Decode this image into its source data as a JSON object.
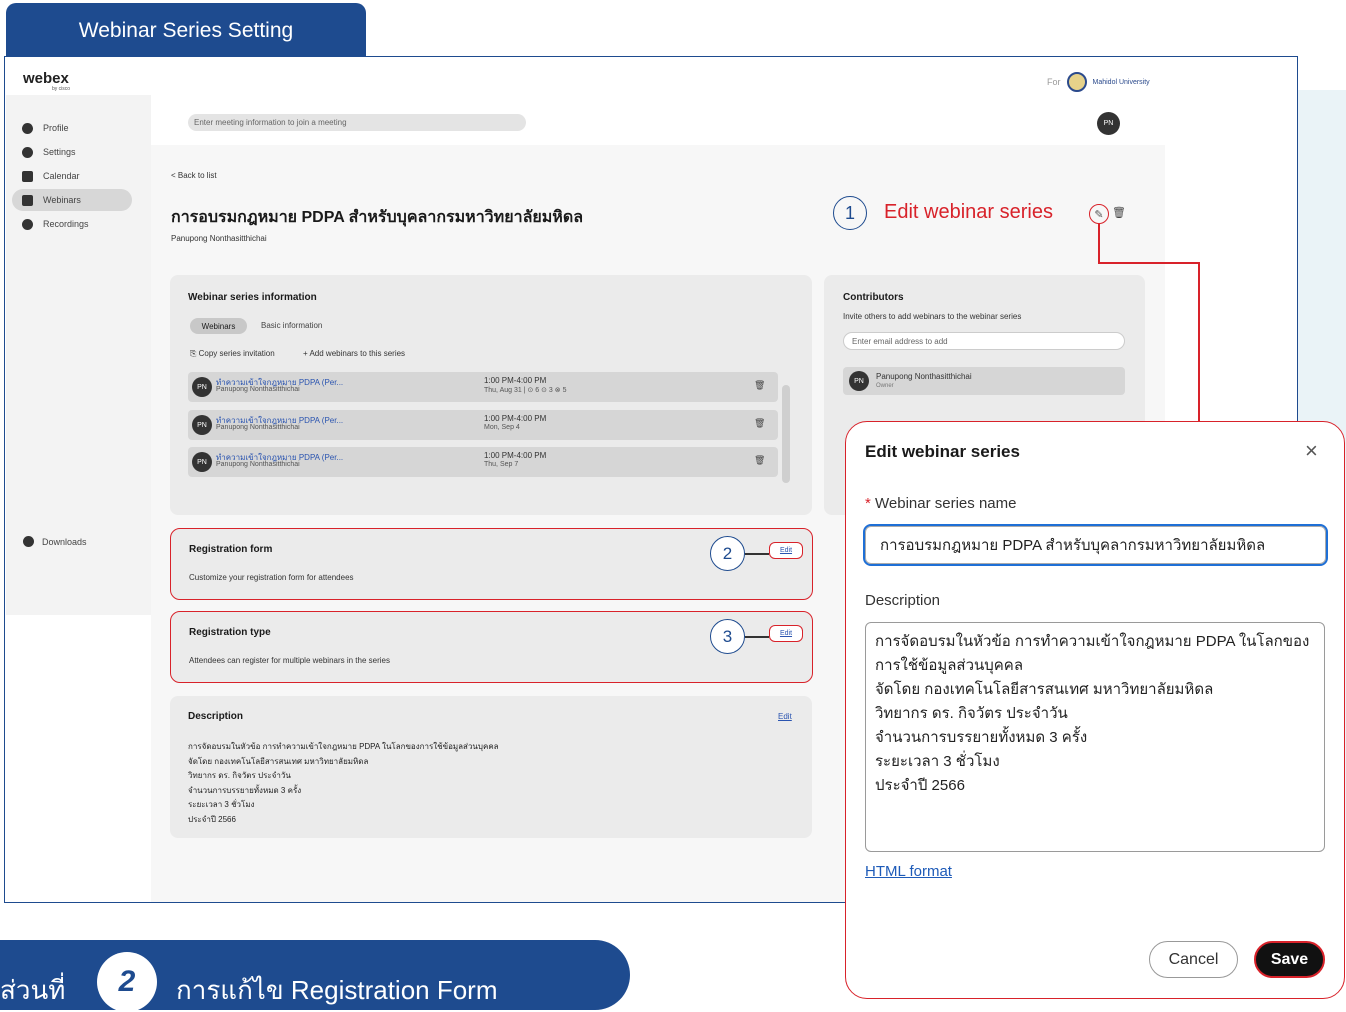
{
  "header_tab": "Webinar Series Setting",
  "app": {
    "brand": "webex",
    "brand_sub": "by cisco",
    "org_prefix": "For",
    "org_name": "Mahidol University",
    "search_placeholder": "Enter meeting information to join a meeting",
    "user_initials": "PN"
  },
  "sidebar": {
    "items": [
      {
        "label": "Profile",
        "icon": "profile-icon"
      },
      {
        "label": "Settings",
        "icon": "gear-icon"
      },
      {
        "label": "Calendar",
        "icon": "calendar-icon"
      },
      {
        "label": "Webinars",
        "icon": "webinar-icon",
        "active": true
      },
      {
        "label": "Recordings",
        "icon": "recording-icon"
      }
    ],
    "downloads": "Downloads"
  },
  "page": {
    "back": "< Back to list",
    "title": "การอบรมกฎหมาย PDPA สำหรับบุคลากรมหาวิทยาลัยมหิดล",
    "owner": "Panupong Nonthasitthichai"
  },
  "callouts": {
    "one_num": "1",
    "one_text": "Edit webinar series",
    "two_num": "2",
    "three_num": "3"
  },
  "info": {
    "title": "Webinar series information",
    "tab_webinars": "Webinars",
    "tab_basic": "Basic information",
    "copy_invitation": "Copy series invitation",
    "add_webinars": "+ Add webinars to this series",
    "rows": [
      {
        "initials": "PN",
        "name": "ทำความเข้าใจกฎหมาย PDPA (Per...",
        "owner": "Panupong Nonthasitthichai",
        "time": "1:00 PM-4:00 PM",
        "date": "Thu, Aug 31 | ⊙ 6 ⊙ 3 ⊗ 5"
      },
      {
        "initials": "PN",
        "name": "ทำความเข้าใจกฎหมาย PDPA (Per...",
        "owner": "Panupong Nonthasitthichai",
        "time": "1:00 PM-4:00 PM",
        "date": "Mon, Sep 4"
      },
      {
        "initials": "PN",
        "name": "ทำความเข้าใจกฎหมาย PDPA (Per...",
        "owner": "Panupong Nonthasitthichai",
        "time": "1:00 PM-4:00 PM",
        "date": "Thu, Sep 7"
      }
    ]
  },
  "contributors": {
    "title": "Contributors",
    "subtitle": "Invite others to add webinars to the webinar series",
    "input_placeholder": "Enter email address to add",
    "initials": "PN",
    "name": "Panupong Nonthasitthichai",
    "role": "Owner"
  },
  "registration_form": {
    "title": "Registration form",
    "subtitle": "Customize your registration form for attendees",
    "edit": "Edit"
  },
  "registration_type": {
    "title": "Registration type",
    "subtitle": "Attendees can register for multiple webinars in the series",
    "edit": "Edit"
  },
  "description": {
    "title": "Description",
    "edit": "Edit",
    "lines": [
      "การจัดอบรมในหัวข้อ การทำความเข้าใจกฎหมาย PDPA ในโลกของการใช้ข้อมูลส่วนบุคคล",
      "จัดโดย กองเทคโนโลยีสารสนเทศ มหาวิทยาลัยมหิดล",
      "วิทยากร ดร. กิจวัตร ประจำวัน",
      "จำนวนการบรรยายทั้งหมด 3 ครั้ง",
      "ระยะเวลา 3 ชั่วโมง",
      "ประจำปี 2566"
    ]
  },
  "dialog": {
    "title": "Edit webinar series",
    "close": "×",
    "name_label": "Webinar series name",
    "name_required": "*",
    "name_value": "การอบรมกฎหมาย PDPA สำหรับบุคลากรมหาวิทยาลัยมหิดล",
    "desc_label": "Description",
    "desc_lines": [
      "การจัดอบรมในหัวข้อ การทำความเข้าใจกฎหมาย PDPA ในโลกของ",
      "การใช้ข้อมูลส่วนบุคคล",
      "จัดโดย กองเทคโนโลยีสารสนเทศ มหาวิทยาลัยมหิดล",
      "วิทยากร ดร. กิจวัตร ประจำวัน",
      "จำนวนการบรรยายทั้งหมด 3 ครั้ง",
      "ระยะเวลา 3 ชั่วโมง",
      "ประจำปี 2566"
    ],
    "html_format": "HTML format",
    "cancel": "Cancel",
    "save": "Save"
  },
  "bottom_banner": {
    "prefix": "ส่วนที่",
    "number": "2",
    "text": "การแก้ไข Registration Form"
  }
}
